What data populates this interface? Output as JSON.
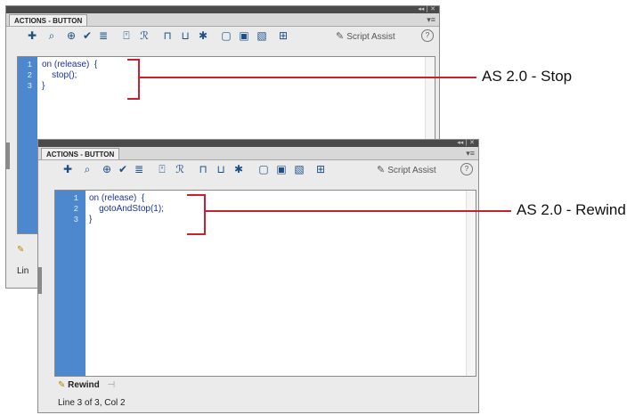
{
  "panel_back": {
    "title": "ACTIONS - BUTTON",
    "window_controls": "◂◂ | ✕",
    "panel_menu": "▾≡",
    "script_assist": "Script Assist",
    "help": "?",
    "code_lines": [
      {
        "num": "1",
        "text": "on (release)  {"
      },
      {
        "num": "2",
        "text": "    stop();"
      },
      {
        "num": "3",
        "text": "}"
      }
    ],
    "bottom_tab_fragment": "​",
    "status_fragment": "Lin"
  },
  "panel_front": {
    "title": "ACTIONS - BUTTON",
    "window_controls": "◂◂ | ✕",
    "panel_menu": "▾≡",
    "script_assist": "Script Assist",
    "help": "?",
    "code_lines": [
      {
        "num": "1",
        "text": "on (release)  {"
      },
      {
        "num": "2",
        "text": "    gotoAndStop(1);"
      },
      {
        "num": "3",
        "text": "}"
      }
    ],
    "bottom_tab": "Rewind",
    "pin_icon": "⊣",
    "status": "Line 3 of 3, Col 2"
  },
  "toolbar_icons": [
    {
      "name": "add-statement-icon",
      "glyph": "✚"
    },
    {
      "name": "find-icon",
      "glyph": "⌕"
    },
    {
      "name": "target-path-icon",
      "glyph": "⊕"
    },
    {
      "name": "check-syntax-icon",
      "glyph": "✔"
    },
    {
      "name": "auto-format-icon",
      "glyph": "≣"
    },
    {
      "name": "code-hint-icon",
      "glyph": "⍞"
    },
    {
      "name": "debug-options-icon",
      "glyph": "ℛ"
    },
    {
      "name": "collapse-braces-icon",
      "glyph": "⊓"
    },
    {
      "name": "collapse-selection-icon",
      "glyph": "⊔"
    },
    {
      "name": "expand-all-icon",
      "glyph": "✱"
    },
    {
      "name": "comment-block-icon",
      "glyph": "▢"
    },
    {
      "name": "comment-line-icon",
      "glyph": "▣"
    },
    {
      "name": "remove-comment-icon",
      "glyph": "▧"
    },
    {
      "name": "show-hide-toolbox-icon",
      "glyph": "⊞"
    }
  ],
  "callouts": {
    "stop": "AS 2.0 - Stop",
    "rewind": "AS 2.0 - Rewind"
  },
  "colors": {
    "gutter": "#4d88cf",
    "code_text": "#1a33a4",
    "callout": "#c8202e",
    "titlebar": "#4a4a4a"
  }
}
